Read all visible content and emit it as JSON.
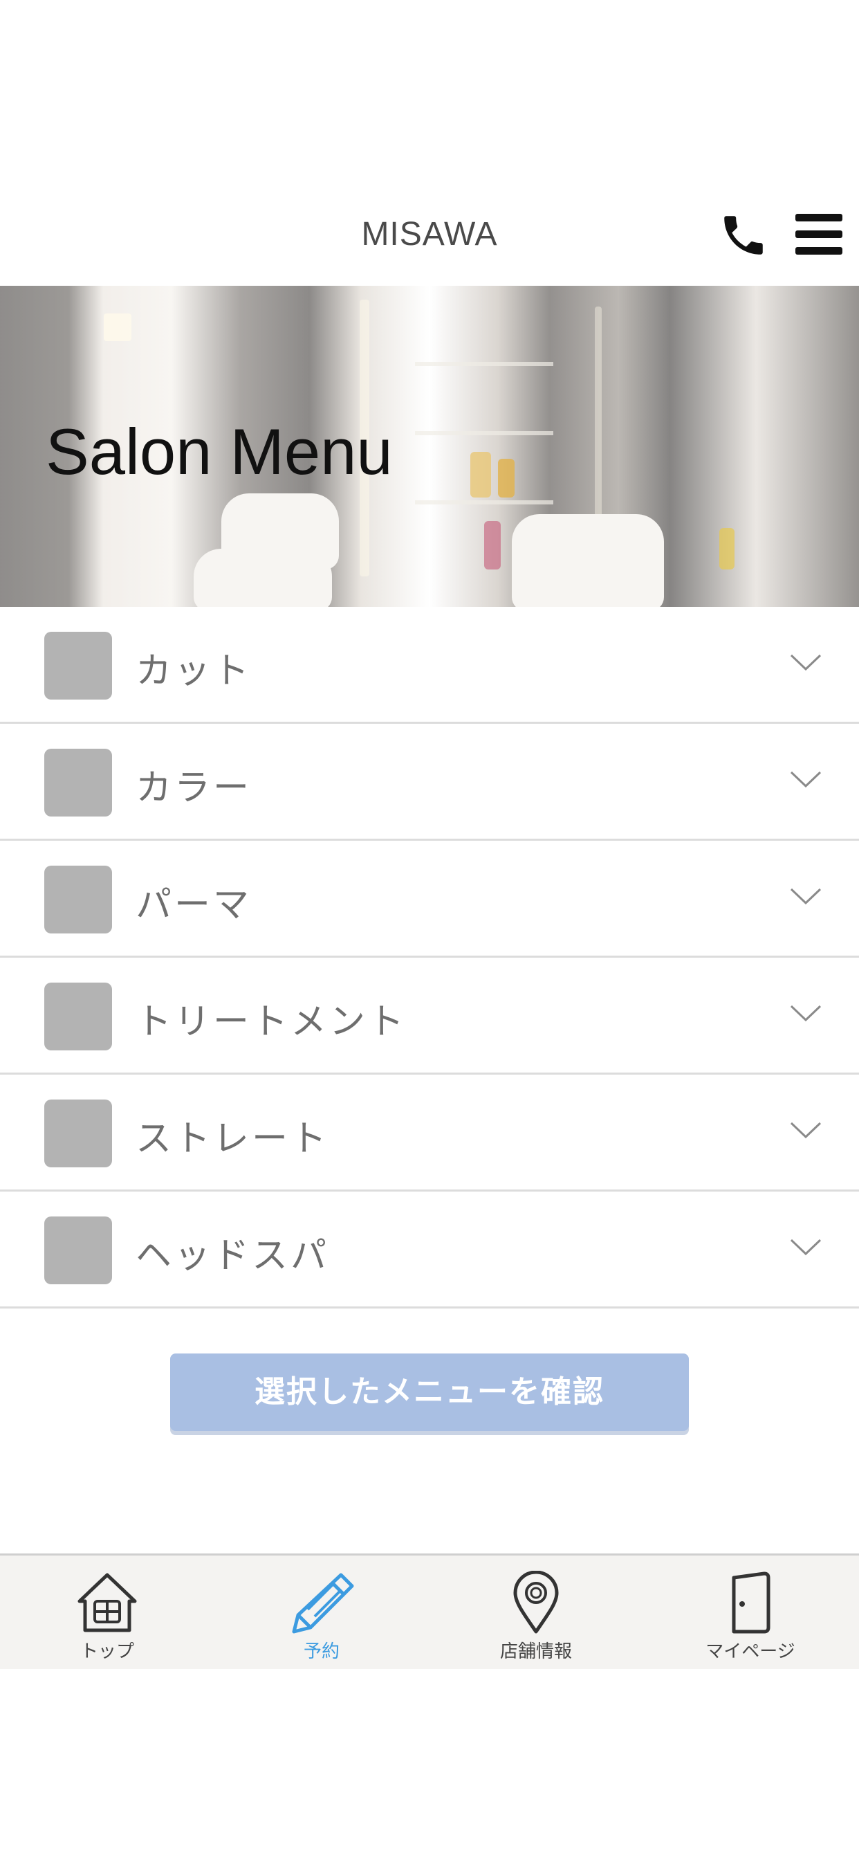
{
  "header": {
    "title": "MISAWA",
    "phone_icon": "phone-icon",
    "menu_icon": "hamburger-menu-icon"
  },
  "hero": {
    "title": "Salon Menu"
  },
  "menu": {
    "items": [
      {
        "label": "カット"
      },
      {
        "label": "カラー"
      },
      {
        "label": "パーマ"
      },
      {
        "label": "トリートメント"
      },
      {
        "label": "ストレート"
      },
      {
        "label": "ヘッドスパ"
      }
    ],
    "chevron_icon": "chevron-down-icon"
  },
  "confirm": {
    "label": "選択したメニューを確認"
  },
  "tabbar": {
    "tabs": [
      {
        "label": "トップ",
        "icon": "home-icon",
        "active": false
      },
      {
        "label": "予約",
        "icon": "pencil-icon",
        "active": true
      },
      {
        "label": "店舗情報",
        "icon": "map-pin-icon",
        "active": false
      },
      {
        "label": "マイページ",
        "icon": "door-icon",
        "active": false
      }
    ]
  },
  "colors": {
    "active_tab": "#3c9be0",
    "confirm_button": "#a9bfe3",
    "thumb_placeholder": "#b3b3b3",
    "tabbar_bg": "#f4f3f1"
  }
}
